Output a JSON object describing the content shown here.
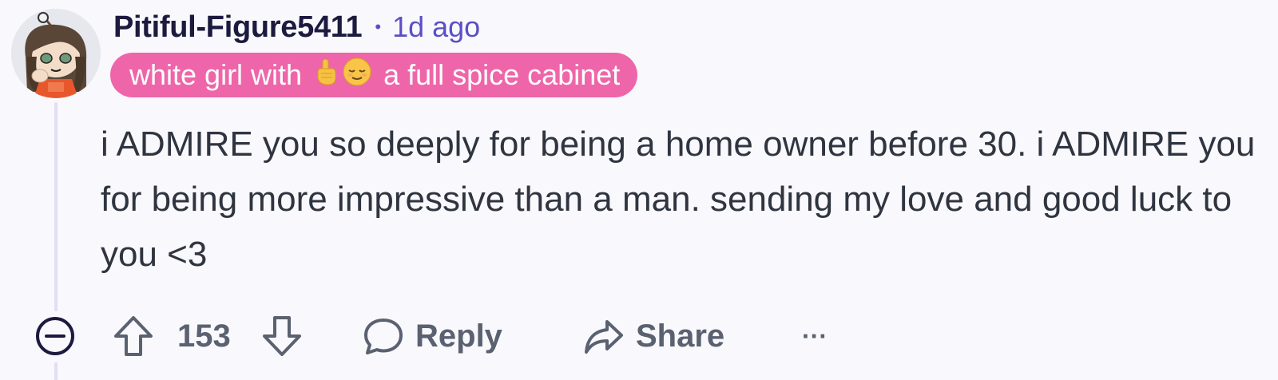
{
  "comment": {
    "author": "Pitiful-Figure5411",
    "separator": "•",
    "time_ago": "1d ago",
    "flair": {
      "text_before": "white girl with",
      "emojis": [
        "pointing-up-emoji",
        "relieved-face-emoji"
      ],
      "text_after": "a full spice cabinet",
      "color": "#ee66a9"
    },
    "body": "i ADMIRE you so deeply for being a home owner before 30. i ADMIRE you for being more impressive than a man. sending my love and good luck to you <3",
    "score": "153"
  },
  "actions": {
    "reply_label": "Reply",
    "share_label": "Share",
    "more_label": "···"
  },
  "colors": {
    "background": "#f9f8fc",
    "username": "#1c1a3e",
    "timestamp": "#5b4fc4",
    "thread_line": "#e2def3",
    "action_gray": "#5a6170"
  }
}
